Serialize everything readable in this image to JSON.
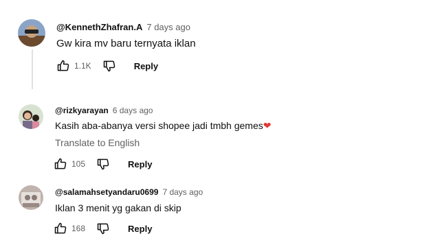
{
  "comments": [
    {
      "author": "@KennethZhafran.A",
      "time": "7 days ago",
      "text": "Gw kira mv baru ternyata iklan",
      "likes": "1.1K",
      "reply_label": "Reply"
    },
    {
      "author": "@rizkyarayan",
      "time": "6 days ago",
      "text": "Kasih aba-abanya versi shopee jadi tmbh gemes",
      "emoji": "❤",
      "translate": "Translate to English",
      "likes": "105",
      "reply_label": "Reply"
    },
    {
      "author": "@salamahsetyandaru0699",
      "time": "7 days ago",
      "text": "Iklan 3 menit yg gakan di skip",
      "likes": "168",
      "reply_label": "Reply"
    }
  ],
  "icons": {
    "like": "thumb-up-icon",
    "dislike": "thumb-down-icon"
  },
  "colors": {
    "heart": "#e53935",
    "secondary_text": "#606060"
  }
}
